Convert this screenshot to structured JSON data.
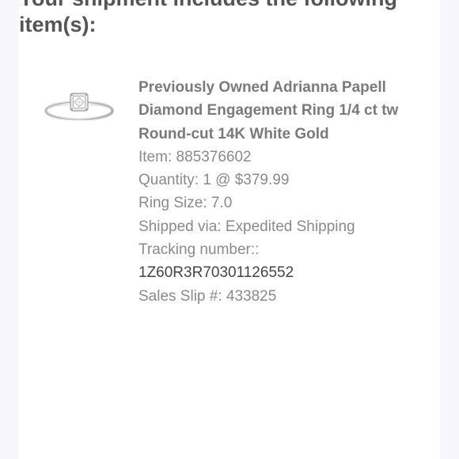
{
  "heading": {
    "line1": "Your shipment includes the following",
    "line2": "item(s):"
  },
  "item": {
    "image_icon": "diamond-ring",
    "title_line1": "Previously Owned Adrianna Papell",
    "title_line2": "Diamond Engagement Ring 1/4 ct tw",
    "title_line3": "Round-cut 14K White Gold",
    "item_number": "Item: 885376602",
    "quantity": "Quantity: 1 @ $379.99",
    "ring_size": "Ring Size: 7.0",
    "shipped_via": "Shipped via: Expedited Shipping",
    "tracking_label": "Tracking number::",
    "tracking_number": "1Z60R3R70301126552",
    "sales_slip": "Sales Slip #: 433825"
  },
  "colors": {
    "background": "#f7f6fc",
    "card": "#ffffff",
    "heading": "#555555",
    "detail_text": "#8a8a8a"
  }
}
